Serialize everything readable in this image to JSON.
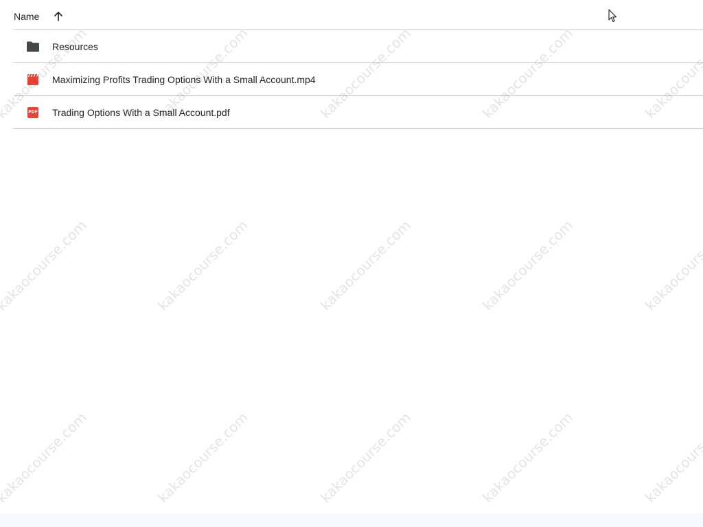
{
  "list_header": {
    "name_label": "Name",
    "sort_icon": "arrow-upward-icon",
    "sort_direction": "ascending"
  },
  "files": [
    {
      "name": "Resources",
      "type": "folder",
      "icon": "folder-icon",
      "icon_color": "#444746"
    },
    {
      "name": "Maximizing Profits Trading Options With a Small Account.mp4",
      "type": "video",
      "icon": "video-clapper-icon",
      "icon_color": "#ea4335"
    },
    {
      "name": "Trading Options With a Small Account.pdf",
      "type": "pdf",
      "icon": "pdf-icon",
      "icon_color": "#ea4335",
      "icon_text": "PDF"
    }
  ],
  "watermark": {
    "text": "kakaocourse.com"
  },
  "colors": {
    "divider": "#c7c7c7",
    "text": "#1f1f1f",
    "bottom_bar": "#f8f9fe"
  }
}
